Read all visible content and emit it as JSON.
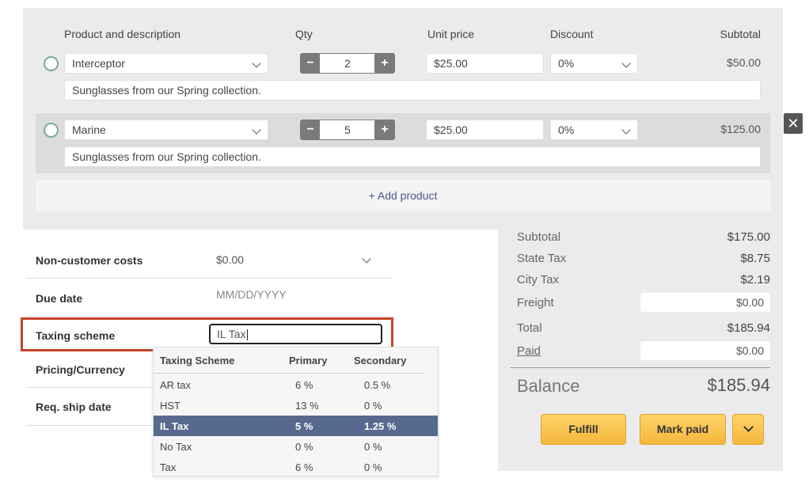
{
  "products": {
    "headers": {
      "product": "Product and description",
      "qty": "Qty",
      "unit_price": "Unit price",
      "discount": "Discount",
      "subtotal": "Subtotal"
    },
    "rows": [
      {
        "name": "Interceptor",
        "qty": "2",
        "unit_price": "$25.00",
        "discount": "0%",
        "subtotal": "$50.00",
        "description": "Sunglasses from our Spring collection."
      },
      {
        "name": "Marine",
        "qty": "5",
        "unit_price": "$25.00",
        "discount": "0%",
        "subtotal": "$125.00",
        "description": "Sunglasses from our Spring collection."
      }
    ],
    "add_product_label": "+ Add product",
    "minus_label": "−",
    "plus_label": "+"
  },
  "close_label": "✕",
  "form": {
    "non_customer_costs_label": "Non-customer costs",
    "non_customer_costs_value": "$0.00",
    "due_date_label": "Due date",
    "due_date_placeholder": "MM/DD/YYYY",
    "taxing_scheme_label": "Taxing scheme",
    "taxing_scheme_value": "IL Tax",
    "pricing_currency_label": "Pricing/Currency",
    "req_ship_date_label": "Req. ship date"
  },
  "tax_dropdown": {
    "headers": {
      "scheme": "Taxing Scheme",
      "primary": "Primary",
      "secondary": "Secondary"
    },
    "rows": [
      {
        "scheme": "AR tax",
        "primary": "6 %",
        "secondary": "0.5 %"
      },
      {
        "scheme": "HST",
        "primary": "13 %",
        "secondary": "0 %"
      },
      {
        "scheme": "IL Tax",
        "primary": "5 %",
        "secondary": "1.25 %"
      },
      {
        "scheme": "No Tax",
        "primary": "0 %",
        "secondary": "0 %"
      },
      {
        "scheme": "Tax",
        "primary": "6 %",
        "secondary": "0 %"
      }
    ],
    "selected": "IL Tax"
  },
  "summary": {
    "subtotal_label": "Subtotal",
    "subtotal_value": "$175.00",
    "state_tax_label": "State Tax",
    "state_tax_value": "$8.75",
    "city_tax_label": "City Tax",
    "city_tax_value": "$2.19",
    "freight_label": "Freight",
    "freight_value": "$0.00",
    "total_label": "Total",
    "total_value": "$185.94",
    "paid_label": "Paid",
    "paid_value": "$0.00",
    "balance_label": "Balance",
    "balance_value": "$185.94",
    "fulfill_label": "Fulfill",
    "mark_paid_label": "Mark paid"
  },
  "colors": {
    "accent_button": "#f5b73c",
    "selected_row": "#57698f",
    "highlight_border": "#c8412b"
  }
}
